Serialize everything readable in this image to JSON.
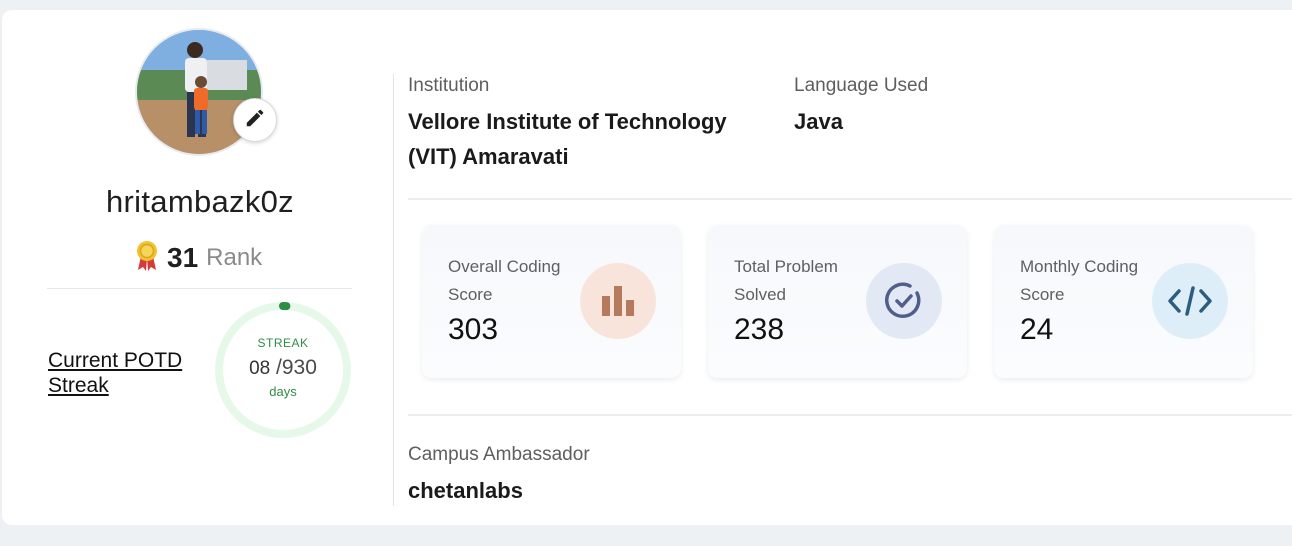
{
  "profile": {
    "username": "hritambazk0z",
    "rank_value": "31",
    "rank_label": "Rank"
  },
  "potd": {
    "title": "Current POTD Streak",
    "streak_label": "STREAK",
    "current": "08",
    "total": "/930",
    "days_label": "days",
    "progress_fraction": 0.0086
  },
  "info": {
    "institution_label": "Institution",
    "institution_value": "Vellore Institute of Technology (VIT) Amaravati",
    "language_label": "Language Used",
    "language_value": "Java",
    "ambassador_label": "Campus Ambassador",
    "ambassador_value": "chetanlabs"
  },
  "stats": [
    {
      "label": "Overall Coding Score",
      "value": "303",
      "icon": "bar-chart-icon",
      "icon_bg": "#f8e4da",
      "icon_color": "#b57a5c"
    },
    {
      "label": "Total Problem Solved",
      "value": "238",
      "icon": "check-circle-icon",
      "icon_bg": "#e3e8f5",
      "icon_color": "#4f5e8a"
    },
    {
      "label": "Monthly Coding Score",
      "value": "24",
      "icon": "code-icon",
      "icon_bg": "#ddeef8",
      "icon_color": "#2d5d7e"
    }
  ],
  "colors": {
    "accent_green": "#2f8d46",
    "streak_track": "#e6f9e9"
  }
}
